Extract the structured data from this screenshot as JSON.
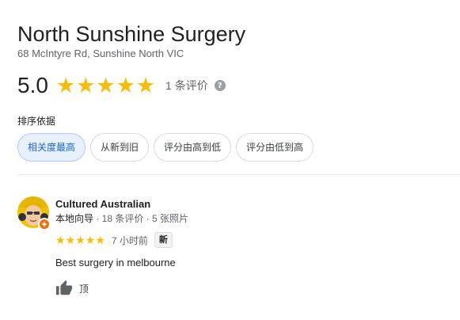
{
  "place": {
    "name": "North Sunshine Surgery",
    "address": "68 McIntyre Rd, Sunshine North VIC",
    "rating": "5.0",
    "star_count": 5,
    "review_count": "1 条评价",
    "help_icon": "?"
  },
  "sort": {
    "label": "排序依据",
    "options": [
      {
        "label": "相关度最高",
        "selected": true
      },
      {
        "label": "从新到旧",
        "selected": false
      },
      {
        "label": "评分由高到低",
        "selected": false
      },
      {
        "label": "评分由低到高",
        "selected": false
      }
    ]
  },
  "review": {
    "author": "Cultured Australian",
    "role": "本地向导",
    "meta": " · 18 条评价 · 5 张照片",
    "rating": 5,
    "time": "7 小时前",
    "badge": "新",
    "text": "Best surgery in melbourne",
    "like_label": "顶"
  },
  "colors": {
    "star": "#fbbc04",
    "chip_selected_bg": "#e8f0fe",
    "chip_selected_text": "#1967d2",
    "local_guide_badge": "#e8710a"
  },
  "icons": {
    "help": "help-circle-icon",
    "local_guide": "local-guide-badge-icon",
    "like": "thumbs-up-icon",
    "star": "star-icon"
  }
}
